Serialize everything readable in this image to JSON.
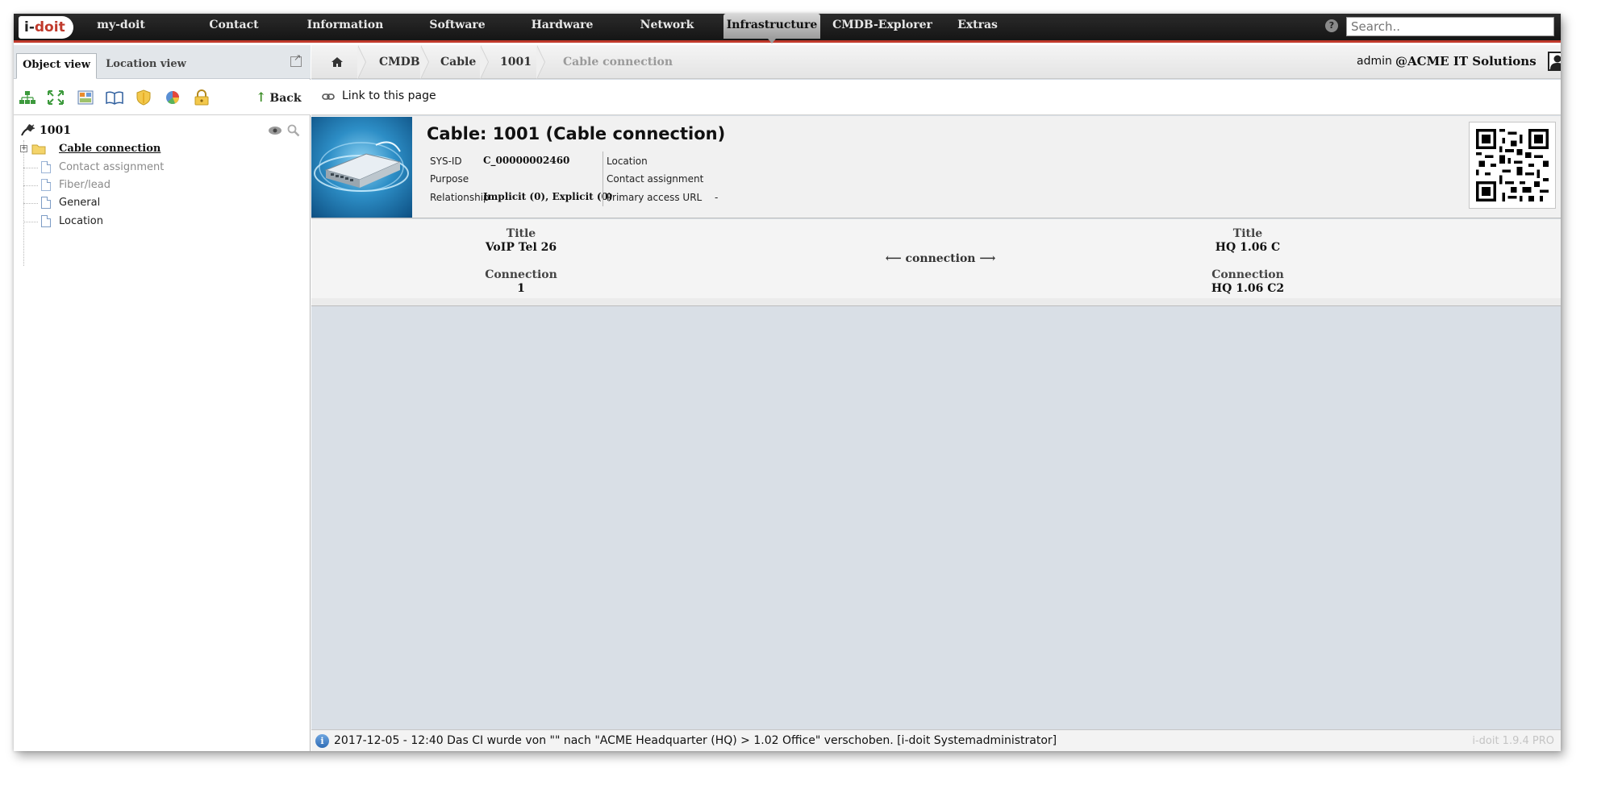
{
  "app": {
    "logo_text_1": "i-",
    "logo_text_2": "doit"
  },
  "nav": {
    "items": [
      {
        "label": "my-doit"
      },
      {
        "label": "Contact"
      },
      {
        "label": "Information"
      },
      {
        "label": "Software"
      },
      {
        "label": "Hardware"
      },
      {
        "label": "Network"
      },
      {
        "label": "Infrastructure",
        "active": true
      },
      {
        "label": "CMDB-Explorer"
      },
      {
        "label": "Extras"
      }
    ],
    "help_icon": "?",
    "search_placeholder": "Search.."
  },
  "left": {
    "tabs": [
      {
        "label": "Object view",
        "active": true
      },
      {
        "label": "Location view"
      }
    ],
    "toolbar_icons": [
      "tree-view-icon",
      "expand-icon",
      "dashboard-icon",
      "book-icon",
      "shield-icon",
      "pie-chart-icon",
      "lock-icon"
    ],
    "back_label": "Back",
    "tree": {
      "root": "1001",
      "items": [
        {
          "label": "Cable connection",
          "active": true
        },
        {
          "label": "Contact assignment",
          "disabled": true
        },
        {
          "label": "Fiber/lead",
          "disabled": true
        },
        {
          "label": "General"
        },
        {
          "label": "Location"
        }
      ]
    }
  },
  "breadcrumb": {
    "items": [
      "CMDB",
      "Cable",
      "1001",
      "Cable connection"
    ]
  },
  "user": {
    "name": "admin",
    "company": "@ACME IT Solutions"
  },
  "link_bar": {
    "label": "Link to this page"
  },
  "object": {
    "title": "Cable: 1001 (Cable connection)",
    "meta_left": [
      {
        "label": "SYS-ID",
        "value": "C_00000002460"
      },
      {
        "label": "Purpose",
        "value": ""
      },
      {
        "label": "Relationship",
        "value": "Implicit (0), Explicit (0)"
      }
    ],
    "meta_right": [
      {
        "label": "Location",
        "value": ""
      },
      {
        "label": "Contact assignment",
        "value": ""
      },
      {
        "label": "Primary access URL",
        "value": "-"
      }
    ]
  },
  "connection": {
    "left": {
      "title_label": "Title",
      "title_value": "VoIP Tel 26",
      "conn_label": "Connection",
      "conn_value": "1"
    },
    "middle": "⟵ connection ⟶",
    "right": {
      "title_label": "Title",
      "title_value": "HQ 1.06 C",
      "conn_label": "Connection",
      "conn_value": "HQ 1.06 C2"
    }
  },
  "status": {
    "message": "2017-12-05 - 12:40 Das CI wurde von \"\" nach \"ACME Headquarter (HQ) > 1.02 Office\" verschoben. [i-doit Systemadministrator]",
    "version": "i-doit 1.9.4 PRO",
    "info_icon": "i"
  },
  "colors": {
    "accent_red": "#c0392b",
    "nav_bg": "#1c1c1c",
    "content_bg": "#d9dfe6"
  }
}
